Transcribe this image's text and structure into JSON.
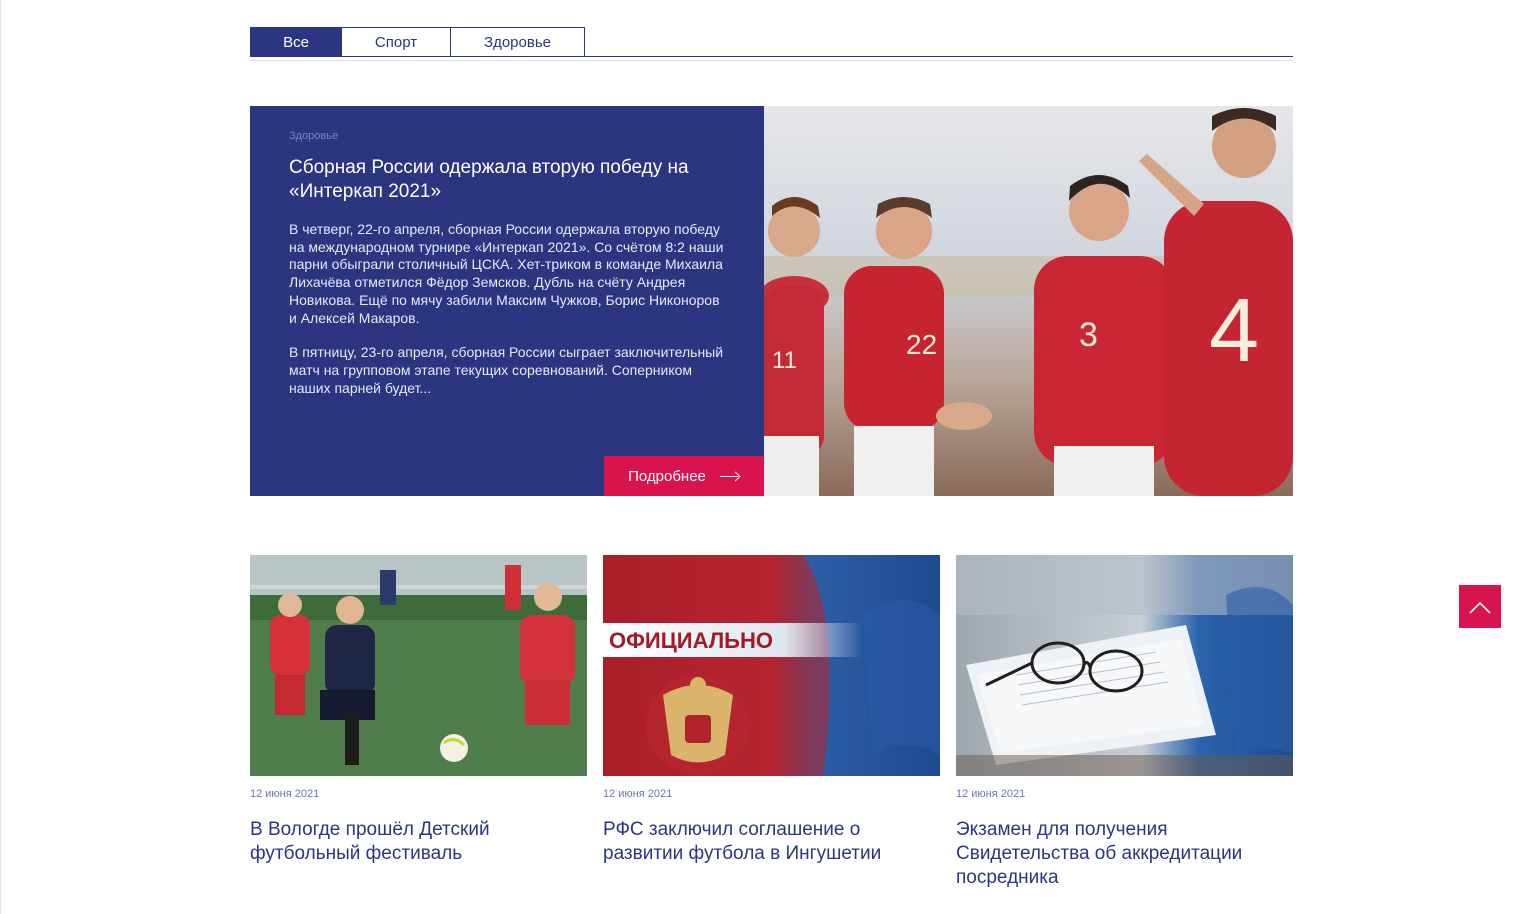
{
  "tabs": [
    {
      "label": "Все",
      "active": true
    },
    {
      "label": "Спорт",
      "active": false
    },
    {
      "label": "Здоровье",
      "active": false
    }
  ],
  "featured": {
    "category": "Здоровье",
    "title": "Сборная России одержала вторую победу на «Интеркап 2021»",
    "paragraph1": "В четверг, 22-го апреля, сборная России одержала вторую победу на международном турнире «Интеркап 2021». Со счётом 8:2 наши парни обыграли столичный ЦСКА. Хет-триком в команде Михаила Лихачёва отметился Фёдор Земсков. Дубль на счёту Андрея Новикова. Ещё по мячу забили Максим Чужков, Борис Никоноров и Алексей Макаров.",
    "paragraph2": "В пятницу, 23-го апреля, сборная России сыграет заключительный матч на групповом этапе текущих соревнований. Соперником наших парней будет...",
    "more_label": "Подробнее",
    "jersey_numbers": [
      "11",
      "22",
      "3",
      "4"
    ]
  },
  "cards": [
    {
      "date": "12 июня 2021",
      "title": "В Вологде прошёл Детский футбольный фестиваль"
    },
    {
      "date": "12 июня 2021",
      "title": "РФС заключил соглашение о развитии футбола в Ингушетии",
      "image_caption": "ОФИЦИАЛЬНО"
    },
    {
      "date": "12 июня 2021",
      "title": "Экзамен для получения Свидетельства об аккредитации посредника"
    }
  ],
  "colors": {
    "brand_blue": "#2b3580",
    "accent_red": "#d8134e"
  },
  "icons": {
    "more": "arrow-right-icon",
    "to_top": "chevron-up-icon"
  }
}
